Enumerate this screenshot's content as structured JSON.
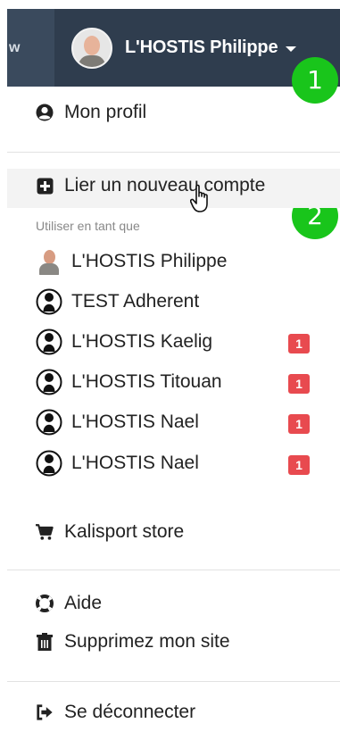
{
  "navbar": {
    "left_fragment": "w",
    "user_name": "L'HOSTIS Philippe",
    "bg_color": "#2f3d4e"
  },
  "steps": [
    "1",
    "2"
  ],
  "menu": {
    "profile": {
      "label": "Mon profil",
      "icon": "user-circle-icon"
    },
    "link_account": {
      "label": "Lier un nouveau compte",
      "icon": "plus-square-icon"
    },
    "use_as_label": "Utiliser en tant que",
    "accounts": [
      {
        "name": "L'HOSTIS Philippe",
        "icon": "avatar-photo",
        "badge": ""
      },
      {
        "name": "TEST Adherent",
        "icon": "user-silhouette-icon",
        "badge": ""
      },
      {
        "name": "L'HOSTIS Kaelig",
        "icon": "user-silhouette-icon",
        "badge": "1"
      },
      {
        "name": "L'HOSTIS Titouan",
        "icon": "user-silhouette-icon",
        "badge": "1"
      },
      {
        "name": "L'HOSTIS Nael",
        "icon": "user-silhouette-icon",
        "badge": "1"
      },
      {
        "name": "L'HOSTIS Nael",
        "icon": "user-silhouette-icon",
        "badge": "1"
      }
    ],
    "store": {
      "label": "Kalisport store",
      "icon": "shopping-cart-icon"
    },
    "help": {
      "label": "Aide",
      "icon": "life-ring-icon"
    },
    "delete_site": {
      "label": "Supprimez mon site",
      "icon": "trash-icon"
    },
    "logout": {
      "label": "Se déconnecter",
      "icon": "sign-out-icon"
    }
  },
  "colors": {
    "badge": "#e84a4f",
    "step": "#19c51b",
    "hover": "#f3f3f3"
  }
}
